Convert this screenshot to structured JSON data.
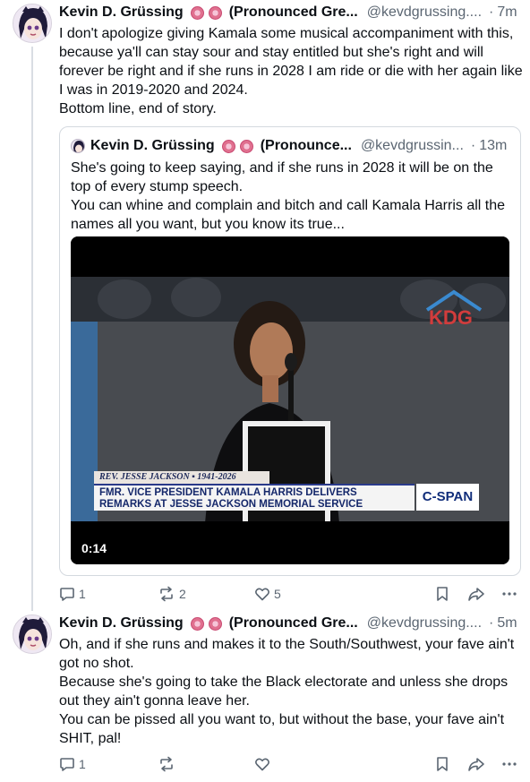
{
  "post1": {
    "author": "Kevin D. Grüssing",
    "pronounced": "(Pronounced Gre...",
    "handle": "@kevdgrussing....",
    "dot": "·",
    "time": "7m",
    "text": "I don't apologize giving Kamala some musical accompaniment with this, because ya'll can stay sour and stay entitled but she's right and will forever be right and if she runs in 2028 I am ride or die with her again like I was in 2019-2020 and 2024.\nBottom line, end of story.",
    "quote": {
      "author": "Kevin D. Grüssing",
      "pronounced": "(Pronounce...",
      "handle": "@kevdgrussin...",
      "dot": "·",
      "time": "13m",
      "text": "She's going to keep saying, and if she runs in 2028 it will be on the top of every stump speech.\nYou can whine and complain and bitch and call Kamala Harris all the names all you want, but you know its true...",
      "video": {
        "duration": "0:14",
        "watermark": "KDG",
        "lower_third_name": "REV. JESSE JACKSON  ▪  1941-2026",
        "lower_third_line1": "FMR. VICE PRESIDENT KAMALA HARRIS DELIVERS",
        "lower_third_line2": "REMARKS AT JESSE JACKSON MEMORIAL SERVICE",
        "network": "C-SPAN"
      }
    },
    "actions": {
      "replies": "1",
      "reposts": "2",
      "likes": "5"
    }
  },
  "post2": {
    "author": "Kevin D. Grüssing",
    "pronounced": "(Pronounced Gre...",
    "handle": "@kevdgrussing....",
    "dot": "·",
    "time": "5m",
    "text": "Oh, and if she runs and makes it to the South/Southwest, your fave ain't got no shot.\nBecause she's going to take the Black electorate and unless she drops out they ain't gonna leave her.\nYou can be pissed all you want to, but without the base, your fave ain't SHIT, pal!",
    "actions": {
      "replies": "1"
    }
  },
  "icons": [
    "reply-icon",
    "repost-icon",
    "like-icon",
    "bookmark-icon",
    "share-icon",
    "more-icon"
  ],
  "colors": {
    "muted": "#5b6672",
    "border": "#d4d9df",
    "text": "#0b0f14"
  }
}
